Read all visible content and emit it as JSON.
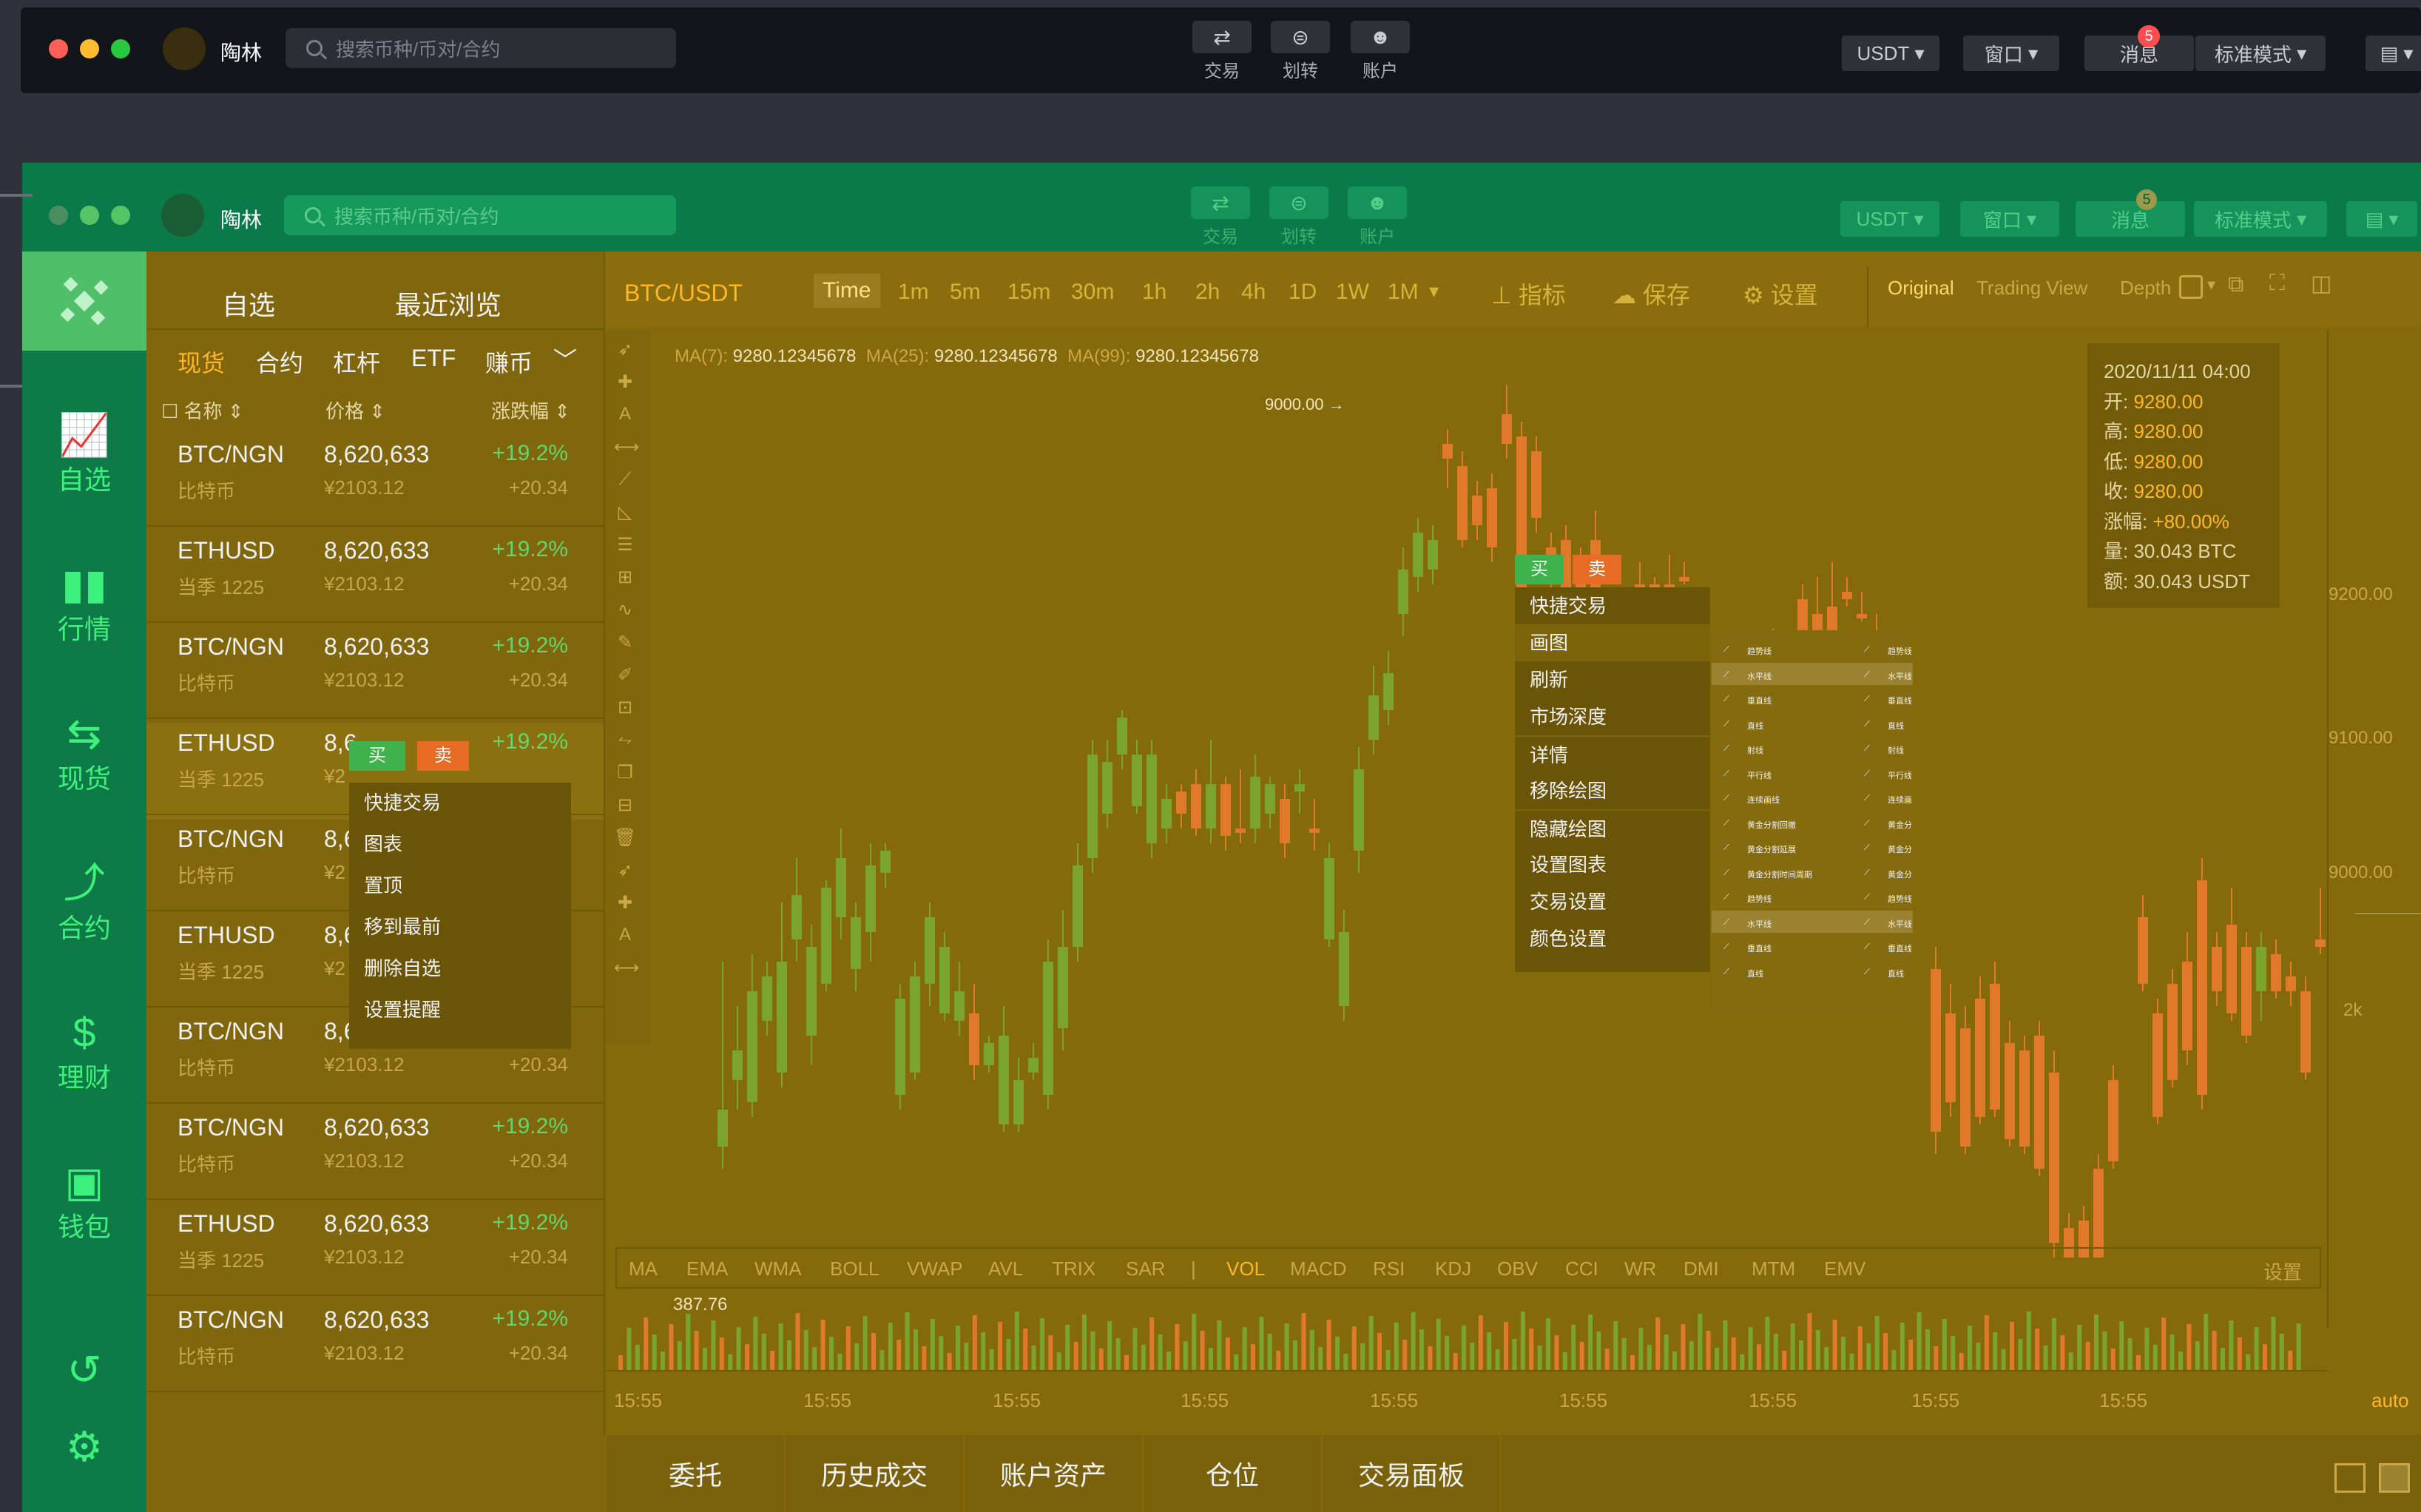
{
  "top_window": {
    "user_name": "陶林",
    "search_placeholder": "搜索币种/币对/合约",
    "icons": [
      {
        "label": "交易",
        "icon": "trade-icon"
      },
      {
        "label": "划转",
        "icon": "transfer-icon"
      },
      {
        "label": "账户",
        "icon": "account-icon"
      }
    ],
    "currency": "USDT",
    "window_label": "窗口",
    "messages_label": "消息",
    "messages_badge": "5",
    "mode_label": "标准模式"
  },
  "main_window": {
    "user_name": "陶林",
    "search_placeholder": "搜索币种/币对/合约",
    "icons": [
      {
        "label": "交易",
        "icon": "trade-icon"
      },
      {
        "label": "划转",
        "icon": "transfer-icon"
      },
      {
        "label": "账户",
        "icon": "account-icon"
      }
    ],
    "currency": "USDT",
    "window_label": "窗口",
    "messages_label": "消息",
    "messages_badge": "5",
    "mode_label": "标准模式"
  },
  "sidebar": {
    "items": [
      {
        "label": "自选",
        "icon": "line-chart-icon"
      },
      {
        "label": "行情",
        "icon": "bar-chart-icon"
      },
      {
        "label": "现货",
        "icon": "spot-icon"
      },
      {
        "label": "合约",
        "icon": "contract-icon"
      },
      {
        "label": "理财",
        "icon": "finance-icon"
      },
      {
        "label": "钱包",
        "icon": "wallet-icon"
      }
    ]
  },
  "watchlist": {
    "tabs": [
      "自选",
      "最近浏览"
    ],
    "categories": [
      "现货",
      "合约",
      "杠杆",
      "ETF",
      "赚币"
    ],
    "columns": [
      "名称",
      "价格",
      "涨跌幅"
    ],
    "rows": [
      {
        "name": "BTC/NGN",
        "sub": "比特币",
        "price": "8,620,633",
        "cny": "¥2103.12",
        "pct": "+19.2%",
        "chg": "+20.34"
      },
      {
        "name": "ETHUSD",
        "sub": "当季 1225",
        "price": "8,620,633",
        "cny": "¥2103.12",
        "pct": "+19.2%",
        "chg": "+20.34"
      },
      {
        "name": "BTC/NGN",
        "sub": "比特币",
        "price": "8,620,633",
        "cny": "¥2103.12",
        "pct": "+19.2%",
        "chg": "+20.34"
      },
      {
        "name": "ETHUSD",
        "sub": "当季 1225",
        "price": "8,6",
        "cny": "¥2",
        "pct": "+19.2%",
        "chg": ""
      },
      {
        "name": "BTC/NGN",
        "sub": "比特币",
        "price": "8,6",
        "cny": "¥2",
        "pct": "",
        "chg": ""
      },
      {
        "name": "ETHUSD",
        "sub": "当季 1225",
        "price": "8,6",
        "cny": "¥2",
        "pct": "",
        "chg": ""
      },
      {
        "name": "BTC/NGN",
        "sub": "比特币",
        "price": "8,6",
        "cny": "¥2103.12",
        "pct": "",
        "chg": "+20.34"
      },
      {
        "name": "BTC/NGN",
        "sub": "比特币",
        "price": "8,620,633",
        "cny": "¥2103.12",
        "pct": "+19.2%",
        "chg": "+20.34"
      },
      {
        "name": "ETHUSD",
        "sub": "当季 1225",
        "price": "8,620,633",
        "cny": "¥2103.12",
        "pct": "+19.2%",
        "chg": "+20.34"
      },
      {
        "name": "BTC/NGN",
        "sub": "比特币",
        "price": "8,620,633",
        "cny": "¥2103.12",
        "pct": "+19.2%",
        "chg": "+20.34"
      }
    ],
    "buy_label": "买",
    "sell_label": "卖",
    "context_menu": [
      "快捷交易",
      "图表",
      "置顶",
      "移到最前",
      "删除自选",
      "设置提醒"
    ]
  },
  "chart_toolbar": {
    "pair": "BTC/USDT",
    "timeframes": [
      "Time",
      "1m",
      "5m",
      "15m",
      "30m",
      "1h",
      "2h",
      "4h",
      "1D",
      "1W",
      "1M"
    ],
    "indicator_label": "指标",
    "save_label": "保存",
    "settings_label": "设置",
    "views": [
      "Original",
      "Trading View",
      "Depth"
    ]
  },
  "chart": {
    "ma_labels": [
      "MA(7):",
      "MA(25):",
      "MA(99):"
    ],
    "ma_values": [
      "9280.12345678",
      "9280.12345678",
      "9280.12345678"
    ],
    "price_marker": "9000.00 →",
    "ohlc": {
      "date": "2020/11/11 04:00",
      "open_label": "开:",
      "open": "9280.00",
      "high_label": "高:",
      "high": "9280.00",
      "low_label": "低:",
      "low": "9280.00",
      "close_label": "收:",
      "close": "9280.00",
      "change_label": "涨幅:",
      "change": "+80.00%",
      "volume_label": "量:",
      "volume": "30.043 BTC",
      "amount_label": "额:",
      "amount": "30.043 USDT"
    },
    "y_ticks": [
      "9200.00",
      "9100.00",
      "9000.00",
      "2k"
    ],
    "x_ticks": [
      "15:55",
      "15:55",
      "15:55",
      "15:55",
      "15:55",
      "15:55",
      "15:55",
      "15:55",
      "15:55"
    ],
    "auto_label": "auto",
    "volume_value": "387.76",
    "buy_label": "买",
    "sell_label": "卖",
    "context_menu": [
      "快捷交易",
      "画图",
      "刷新",
      "市场深度",
      "详情",
      "移除绘图",
      "隐藏绘图",
      "设置图表",
      "交易设置",
      "颜色设置"
    ],
    "draw_tools": [
      "趋势线",
      "水平线",
      "垂直线",
      "直线",
      "射线",
      "平行线",
      "连续画线",
      "黄金分割回撤",
      "黄金分割延展",
      "黄金分割时间周期",
      "趋势线",
      "水平线",
      "垂直线",
      "直线"
    ]
  },
  "indicators": {
    "items": [
      "MA",
      "EMA",
      "WMA",
      "BOLL",
      "VWAP",
      "AVL",
      "TRIX",
      "SAR",
      "|",
      "VOL",
      "MACD",
      "RSI",
      "KDJ",
      "OBV",
      "CCI",
      "WR",
      "DMI",
      "MTM",
      "EMV"
    ],
    "settings_label": "设置"
  },
  "bottom_tabs": [
    "委托",
    "历史成交",
    "账户资产",
    "仓位",
    "交易面板"
  ],
  "colors": {
    "up": "#5fd86e",
    "down": "#ff8a2b",
    "accent": "#3ef07c",
    "overlay": "#856a0c"
  }
}
